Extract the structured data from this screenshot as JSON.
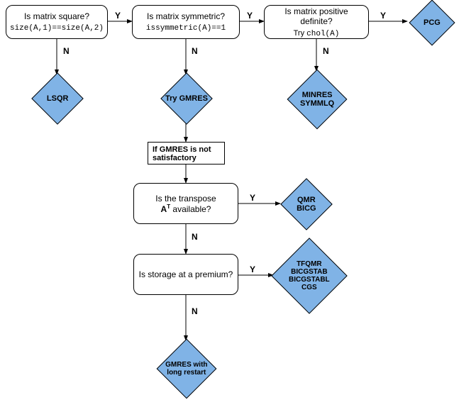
{
  "nodes": {
    "square": {
      "title": "Is matrix square?",
      "code": "size(A,1)==size(A,2)"
    },
    "symmetric": {
      "title": "Is matrix symmetric?",
      "code": "issymmetric(A)==1"
    },
    "posdef": {
      "title": "Is matrix positive definite?",
      "code": "Try chol(A)"
    },
    "transpose": {
      "title_prefix": "Is the transpose",
      "title_var": "A",
      "title_sup": "T",
      "title_suffix": " available?"
    },
    "storage": {
      "title": "Is storage at a premium?"
    },
    "gmres_note": {
      "text": "If GMRES is not satisfactory"
    }
  },
  "results": {
    "lsqr": "LSQR",
    "trygmres": "Try GMRES",
    "minres_line1": "MINRES",
    "minres_line2": "SYMMLQ",
    "pcg": "PCG",
    "qmr_line1": "QMR",
    "qmr_line2": "BICG",
    "tfqmr_line1": "TFQMR",
    "tfqmr_line2": "BICGSTAB",
    "tfqmr_line3": "BICGSTABL",
    "tfqmr_line4": "CGS",
    "gmreslong_line1": "GMRES with",
    "gmreslong_line2": "long restart"
  },
  "labels": {
    "Y": "Y",
    "N": "N"
  },
  "chart_data": {
    "type": "flowchart",
    "decisions": [
      {
        "id": "square",
        "question": "Is matrix square?",
        "test": "size(A,1)==size(A,2)",
        "yes": "symmetric",
        "no": "LSQR"
      },
      {
        "id": "symmetric",
        "question": "Is matrix symmetric?",
        "test": "issymmetric(A)==1",
        "yes": "posdef",
        "no": "Try GMRES"
      },
      {
        "id": "posdef",
        "question": "Is matrix positive definite?",
        "test": "Try chol(A)",
        "yes": "PCG",
        "no": "MINRES / SYMMLQ"
      },
      {
        "id": "gmres_note",
        "note": "If GMRES is not satisfactory",
        "next": "transpose"
      },
      {
        "id": "transpose",
        "question": "Is the transpose A^T available?",
        "yes": "QMR / BICG",
        "no": "storage"
      },
      {
        "id": "storage",
        "question": "Is storage at a premium?",
        "yes": "TFQMR / BICGSTAB / BICGSTABL / CGS",
        "no": "GMRES with long restart"
      }
    ]
  }
}
